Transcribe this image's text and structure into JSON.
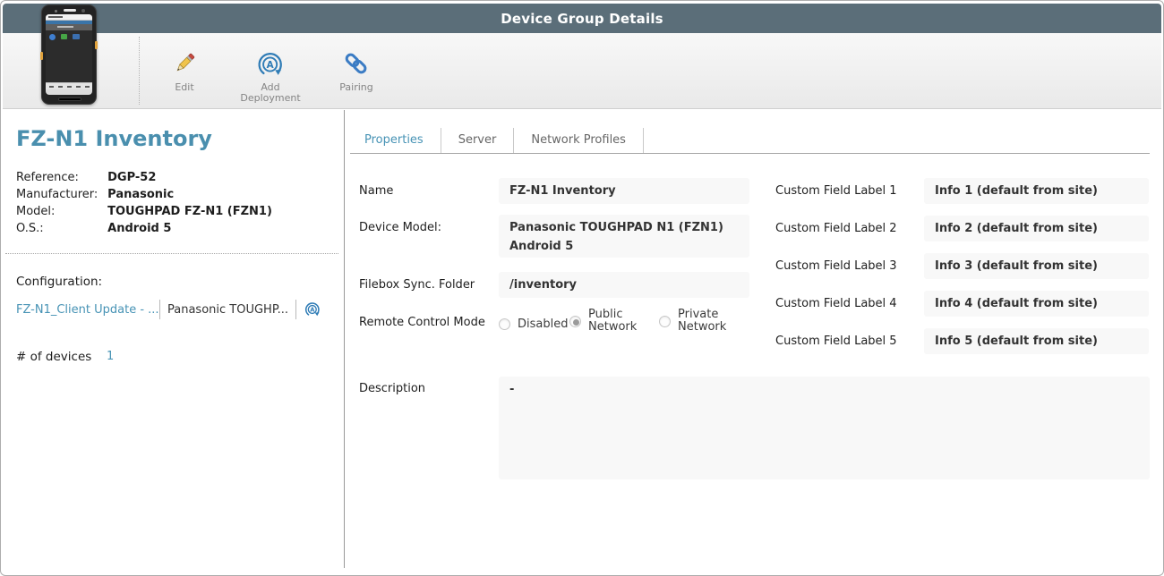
{
  "header": {
    "title": "Device Group Details"
  },
  "toolbar": {
    "buttons": [
      {
        "label": "Edit"
      },
      {
        "label": "Add Deployment"
      },
      {
        "label": "Pairing"
      }
    ]
  },
  "sidebar": {
    "title": "FZ-N1 Inventory",
    "info": [
      {
        "label": "Reference:",
        "value": "DGP-52"
      },
      {
        "label": "Manufacturer:",
        "value": "Panasonic"
      },
      {
        "label": "Model:",
        "value": "TOUGHPAD FZ-N1 (FZN1)"
      },
      {
        "label": "O.S.:",
        "value": "Android 5"
      }
    ],
    "configuration": {
      "label": "Configuration:",
      "link": "FZ-N1_Client Update - ...",
      "value": "Panasonic TOUGHP...",
      "sync_icon": "refresh-a-icon"
    },
    "devices": {
      "label": "# of devices",
      "count": "1"
    }
  },
  "tabs": [
    {
      "label": "Properties",
      "active": true
    },
    {
      "label": "Server",
      "active": false
    },
    {
      "label": "Network Profiles",
      "active": false
    }
  ],
  "form": {
    "name": {
      "label": "Name",
      "value": "FZ-N1 Inventory"
    },
    "device_model": {
      "label": "Device Model:",
      "value_line1": "Panasonic TOUGHPAD N1 (FZN1)",
      "value_line2": "Android 5"
    },
    "filebox": {
      "label": "Filebox Sync. Folder",
      "value": "/inventory"
    },
    "remote_control": {
      "label": "Remote Control Mode",
      "options": [
        {
          "label": "Disabled",
          "selected": false
        },
        {
          "label": "Public Network",
          "selected": true
        },
        {
          "label": "Private Network",
          "selected": false
        }
      ]
    },
    "description": {
      "label": "Description",
      "value": "-"
    }
  },
  "custom_fields": [
    {
      "label": "Custom Field Label 1",
      "value": "Info 1 (default from site)"
    },
    {
      "label": "Custom Field Label 2",
      "value": "Info 2 (default from site)"
    },
    {
      "label": "Custom Field Label 3",
      "value": "Info 3 (default from site)"
    },
    {
      "label": "Custom Field Label 4",
      "value": "Info 4 (default from site)"
    },
    {
      "label": "Custom Field Label 5",
      "value": "Info 5 (default from site)"
    }
  ],
  "colors": {
    "header_bg": "#5b6e79",
    "accent": "#4793b5",
    "title_accent": "#4a8fae",
    "field_bg": "#f8f8f8",
    "icon_blue": "#2f7cb6"
  }
}
